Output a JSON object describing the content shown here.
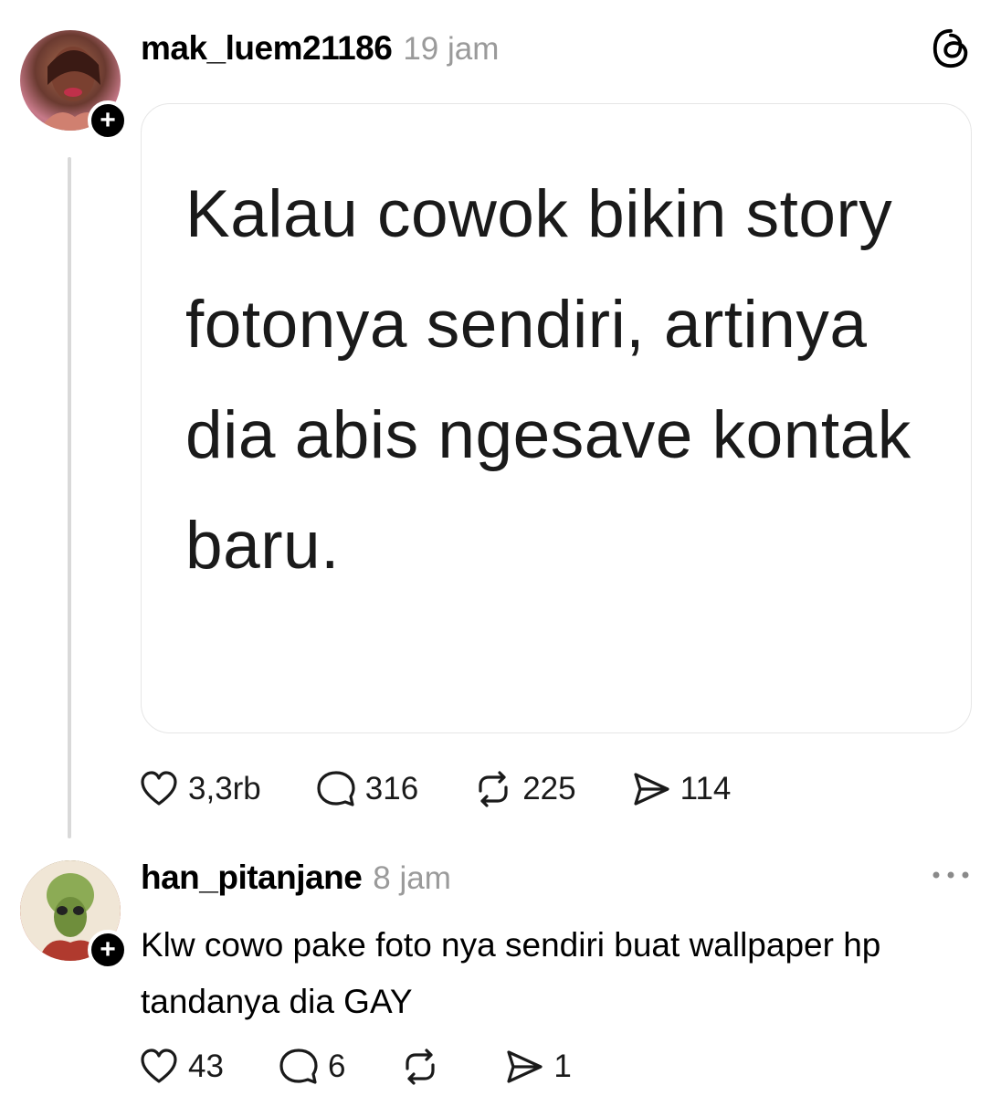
{
  "post": {
    "username": "mak_luem21186",
    "timestamp": "19 jam",
    "image_text": "Kalau cowok bikin story fotonya sendiri, artinya dia abis ngesave kontak baru.",
    "likes": "3,3rb",
    "replies": "316",
    "reposts": "225",
    "shares": "114"
  },
  "reply": {
    "username": "han_pitanjane",
    "timestamp": "8 jam",
    "text": "Klw cowo pake foto nya sendiri buat wallpaper hp tandanya dia GAY",
    "likes": "43",
    "replies": "6",
    "reposts": "",
    "shares": "1"
  },
  "icons": {
    "app": "threads-icon",
    "like": "heart-icon",
    "reply": "comment-icon",
    "repost": "repost-icon",
    "share": "send-icon",
    "more": "more-dots-icon",
    "follow": "plus-icon"
  }
}
